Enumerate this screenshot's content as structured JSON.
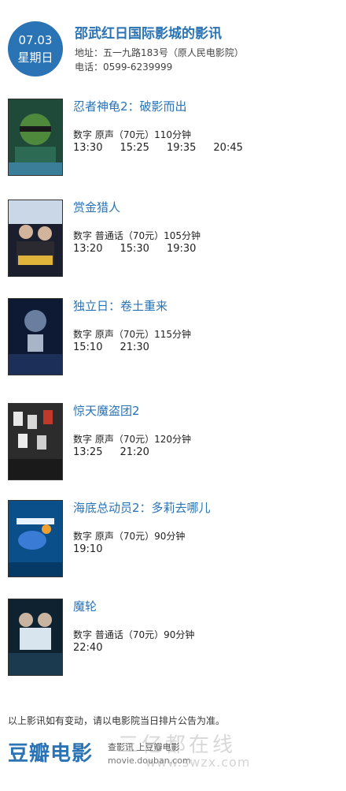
{
  "header": {
    "date": "07.03",
    "weekday": "星期日",
    "title": "邵武红日国际影城的影讯",
    "address": "地址：五一九路183号（原人民电影院）",
    "phone": "电话：0599-6239999"
  },
  "movies": [
    {
      "title": "忍者神龟2：破影而出",
      "info": "数字  原声（70元）110分钟",
      "times": [
        "13:30",
        "15:25",
        "19:35",
        "20:45"
      ]
    },
    {
      "title": "赏金猎人",
      "info": "数字  普通话（70元）105分钟",
      "times": [
        "13:20",
        "15:30",
        "19:30"
      ]
    },
    {
      "title": "独立日：卷土重来",
      "info": "数字  原声（70元）115分钟",
      "times": [
        "15:10",
        "21:30"
      ]
    },
    {
      "title": "惊天魔盗团2",
      "info": "数字  原声（70元）120分钟",
      "times": [
        "13:25",
        "21:20"
      ]
    },
    {
      "title": "海底总动员2：多莉去哪儿",
      "info": "数字  原声（70元）90分钟",
      "times": [
        "19:10"
      ]
    },
    {
      "title": "魔轮",
      "info": "数字  普通话（70元）90分钟",
      "times": [
        "22:40"
      ]
    }
  ],
  "footer": {
    "note": "以上影讯如有变动，请以电影院当日排片公告为准。",
    "logo": "豆瓣电影",
    "links": "查影讯 上豆瓣电影",
    "url": "movie.douban.com",
    "watermark": "三亿都在线",
    "watermark_url": "www.swzx.com"
  },
  "colors": {
    "accent": "#2a73b4"
  }
}
